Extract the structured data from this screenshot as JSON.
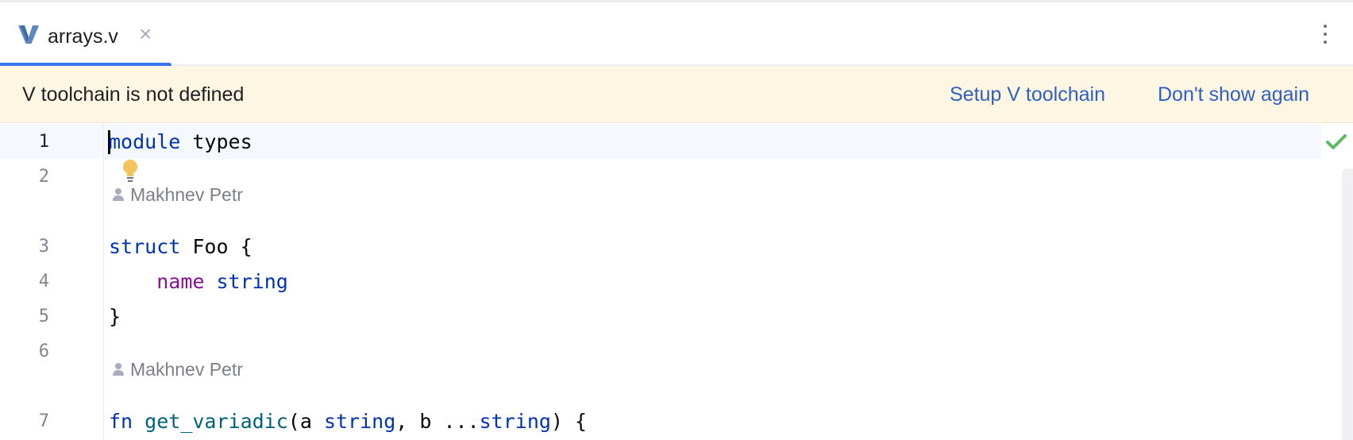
{
  "tab": {
    "icon": "v-language-icon",
    "label": "arrays.v",
    "close_glyph": "×"
  },
  "banner": {
    "message": "V toolchain is not defined",
    "setup_label": "Setup V toolchain",
    "dismiss_label": "Don't show again",
    "background": "#fdf6e3"
  },
  "editor": {
    "line_numbers": [
      "1",
      "2",
      "3",
      "4",
      "5",
      "6",
      "7"
    ],
    "authors": [
      "Makhnev Petr",
      "Makhnev Petr"
    ],
    "code": {
      "l1_kw": "module",
      "l1_rest": " types",
      "l3_kw": "struct",
      "l3_rest": " Foo {",
      "l4_indent": "    ",
      "l4_field": "name",
      "l4_sp": " ",
      "l4_type": "string",
      "l5": "}",
      "l7_kw": "fn",
      "l7_sp": " ",
      "l7_fn": "get_variadic",
      "l7_a": "(a ",
      "l7_t1": "string",
      "l7_b": ", b ...",
      "l7_t2": "string",
      "l7_end": ") {"
    },
    "status": "no-problems-check-icon"
  },
  "colors": {
    "keyword": "#0033b3",
    "function": "#00627a",
    "field": "#871094",
    "link": "#2f5fc4",
    "tab_accent": "#3574f0",
    "check": "#5fb865"
  }
}
